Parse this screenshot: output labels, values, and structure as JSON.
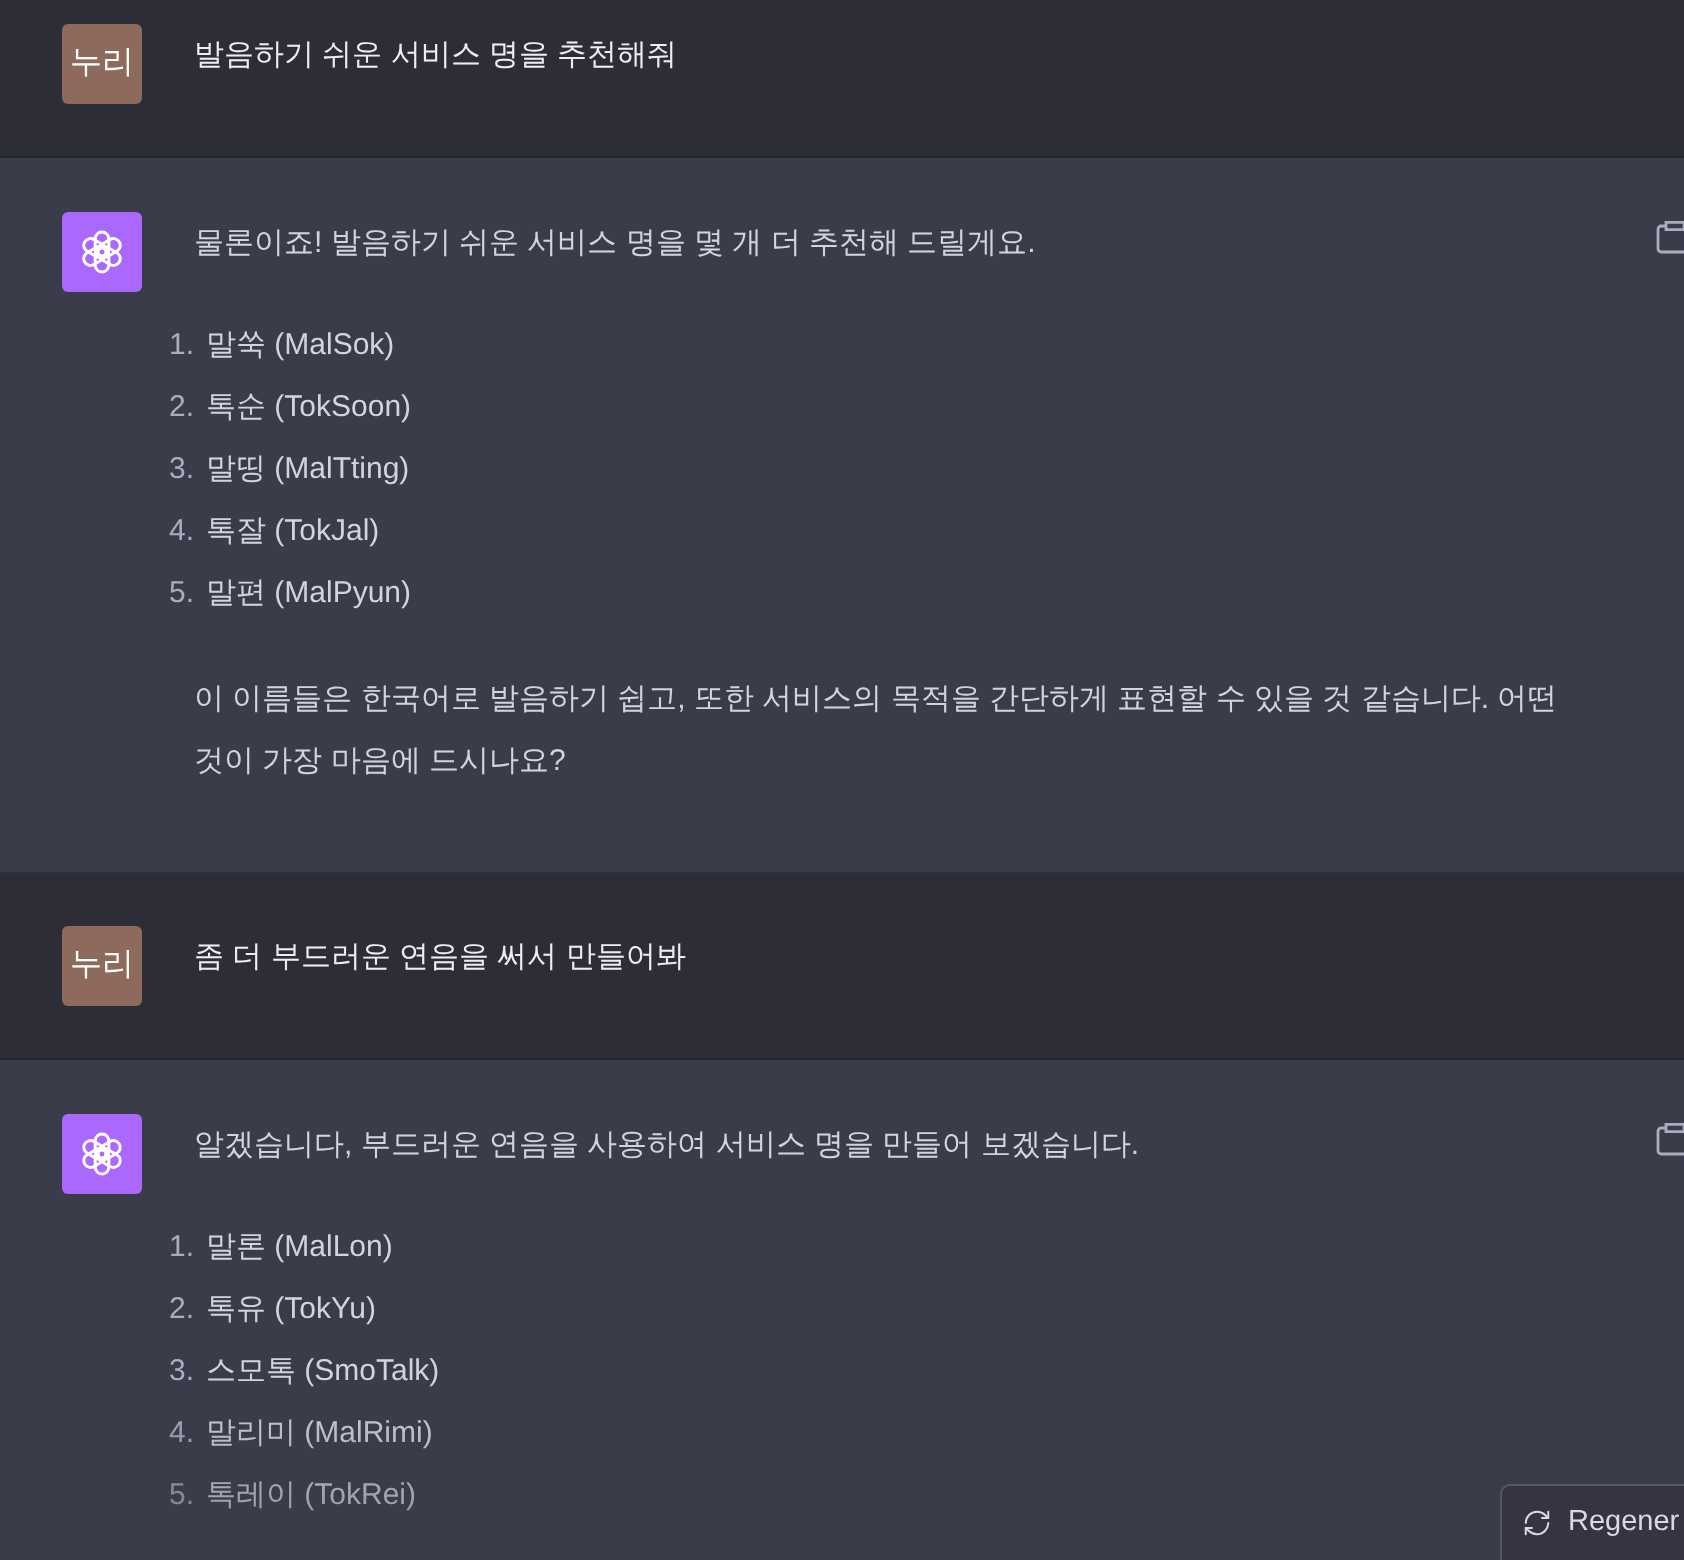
{
  "messages": [
    {
      "kind": "user",
      "avatar": "누리",
      "text": "발음하기 쉬운 서비스 명을 추천해줘"
    },
    {
      "kind": "assistant",
      "intro": "물론이죠! 발음하기 쉬운 서비스 명을 몇 개 더 추천해 드릴게요.",
      "items": [
        {
          "number": "1.",
          "text": "말쑥 (MalSok)"
        },
        {
          "number": "2.",
          "text": "톡순 (TokSoon)"
        },
        {
          "number": "3.",
          "text": "말띵 (MalTting)"
        },
        {
          "number": "4.",
          "text": "톡잘 (TokJal)"
        },
        {
          "number": "5.",
          "text": "말편 (MalPyun)"
        }
      ],
      "outro": "이 이름들은 한국어로 발음하기 쉽고, 또한 서비스의 목적을 간단하게 표현할 수 있을 것 같습니다. 어떤 것이 가장 마음에 드시나요?"
    },
    {
      "kind": "user",
      "avatar": "누리",
      "text": "좀 더 부드러운 연음을 써서 만들어봐"
    },
    {
      "kind": "assistant",
      "intro": "알겠습니다, 부드러운 연음을 사용하여 서비스 명을 만들어 보겠습니다.",
      "items": [
        {
          "number": "1.",
          "text": "말론 (MalLon)"
        },
        {
          "number": "2.",
          "text": "톡유 (TokYu)"
        },
        {
          "number": "3.",
          "text": "스모톡 (SmoTalk)"
        },
        {
          "number": "4.",
          "text": "말리미 (MalRimi)"
        },
        {
          "number": "5.",
          "text": "톡레이 (TokRei)"
        }
      ]
    }
  ],
  "regenerate_button": {
    "label": "Regener"
  }
}
